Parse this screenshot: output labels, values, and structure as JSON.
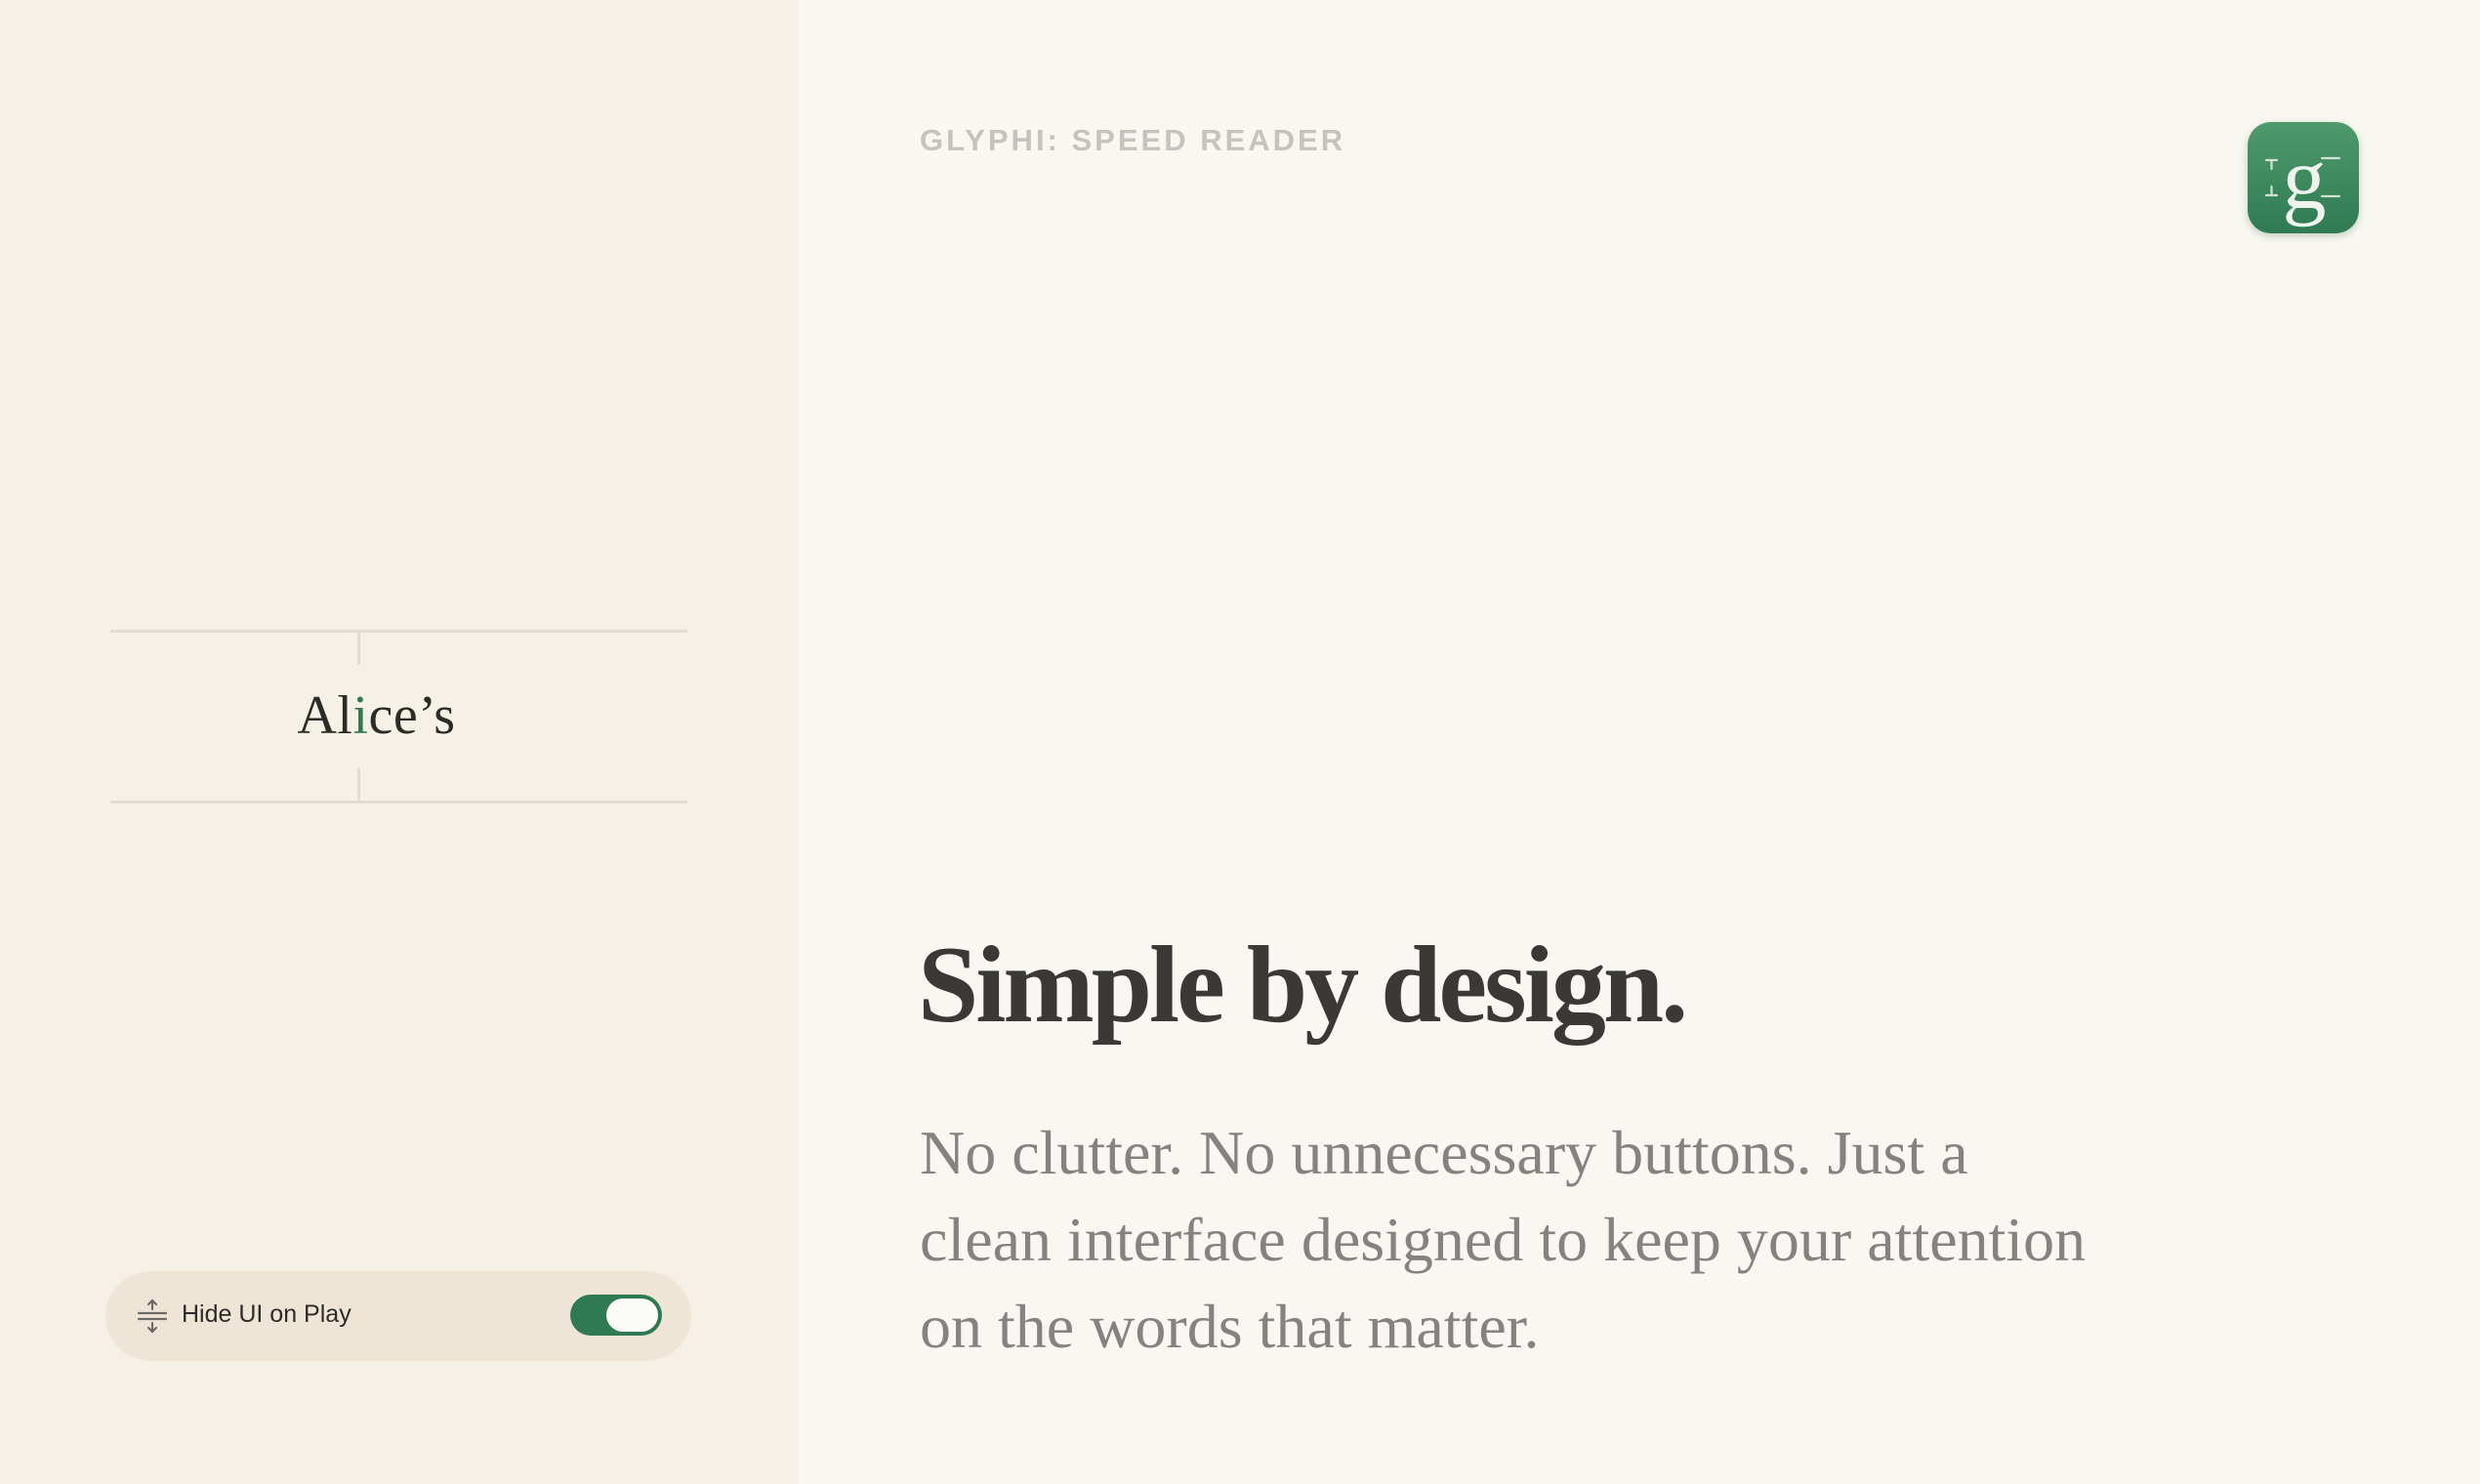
{
  "reader": {
    "word_before": "Al",
    "focus_letter": "i",
    "word_after": "ce’s",
    "focus_color": "#2f7a52"
  },
  "setting": {
    "icon": "expand-vertical-icon",
    "label": "Hide UI on Play",
    "toggle_on": true,
    "toggle_color": "#2f7a52"
  },
  "page": {
    "kicker": "GLYPHI: SPEED READER",
    "app_icon": "glyphi-app-icon",
    "headline": "Simple by design.",
    "body": "No clutter. No unnecessary buttons. Just a clean interface designed to keep your attention on the words that matter."
  }
}
